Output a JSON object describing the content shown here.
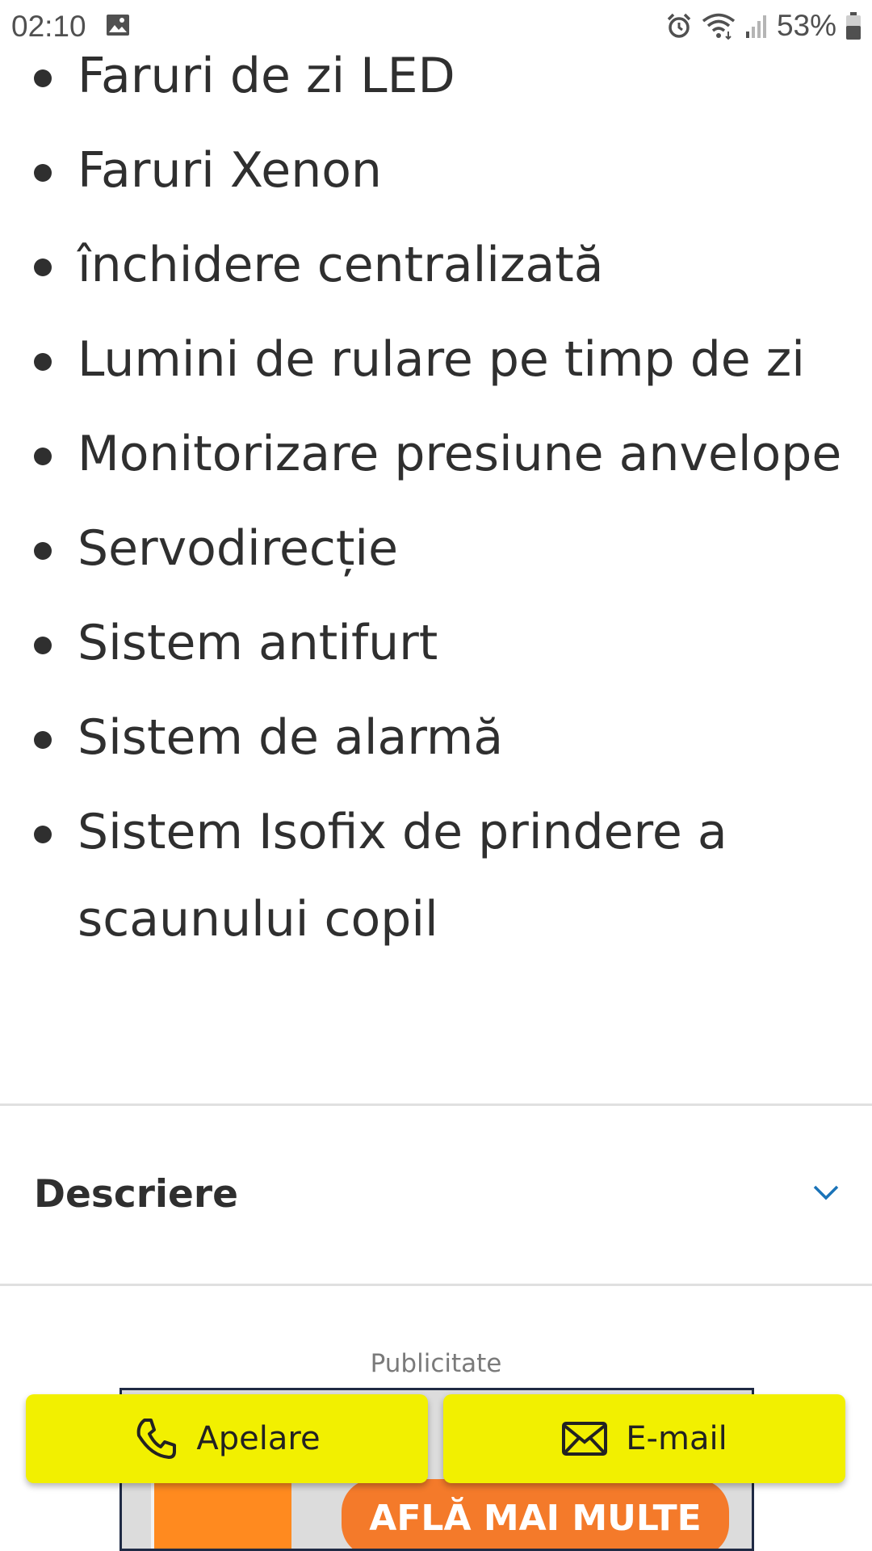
{
  "status_bar": {
    "time": "02:10",
    "battery": "53%",
    "icons": [
      "gallery-icon",
      "alarm-icon",
      "wifi-icon",
      "signal-icon",
      "battery-icon"
    ]
  },
  "features": [
    "Faruri de zi LED",
    "Faruri Xenon",
    "închidere centralizată",
    "Lumini de rulare pe timp de zi",
    "Monitorizare presiune anvelope",
    "Servodirecție",
    "Sistem antifurt",
    "Sistem de alarmă",
    "Sistem Isofix de prindere a scaunului copil"
  ],
  "description_section": {
    "title": "Descriere",
    "icon": "chevron-down-icon"
  },
  "ad": {
    "label": "Publicitate",
    "cta": "AFLĂ MAI MULTE"
  },
  "actions": {
    "call_label": "Apelare",
    "email_label": "E-mail"
  },
  "colors": {
    "action_button": "#f2f000",
    "chevron": "#1a73b8",
    "ad_cta": "#f47a2a"
  }
}
